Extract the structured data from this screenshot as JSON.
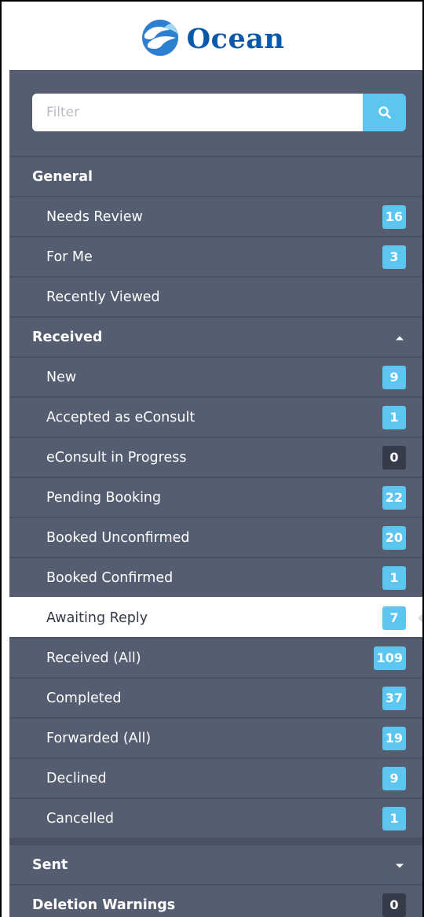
{
  "brand": {
    "name": "Ocean",
    "primary_color": "#0a58a8",
    "accent_color": "#5cc5f0"
  },
  "filter": {
    "placeholder": "Filter",
    "value": "",
    "button_icon": "search-icon"
  },
  "sections": {
    "general": {
      "label": "General",
      "items": [
        {
          "label": "Needs Review",
          "count": "16"
        },
        {
          "label": "For Me",
          "count": "3"
        },
        {
          "label": "Recently Viewed"
        }
      ]
    },
    "received": {
      "label": "Received",
      "expanded": true,
      "items": [
        {
          "label": "New",
          "count": "9"
        },
        {
          "label": "Accepted as eConsult",
          "count": "1"
        },
        {
          "label": "eConsult in Progress",
          "count": "0"
        },
        {
          "label": "Pending Booking",
          "count": "22"
        },
        {
          "label": "Booked Unconfirmed",
          "count": "20"
        },
        {
          "label": "Booked Confirmed",
          "count": "1"
        },
        {
          "label": "Awaiting Reply",
          "count": "7",
          "active": true
        },
        {
          "label": "Received (All)",
          "count": "109"
        },
        {
          "label": "Completed",
          "count": "37"
        },
        {
          "label": "Forwarded (All)",
          "count": "19"
        },
        {
          "label": "Declined",
          "count": "9"
        },
        {
          "label": "Cancelled",
          "count": "1"
        }
      ]
    },
    "sent": {
      "label": "Sent",
      "expanded": false
    },
    "deletion_warnings": {
      "label": "Deletion Warnings",
      "count": "0"
    }
  }
}
